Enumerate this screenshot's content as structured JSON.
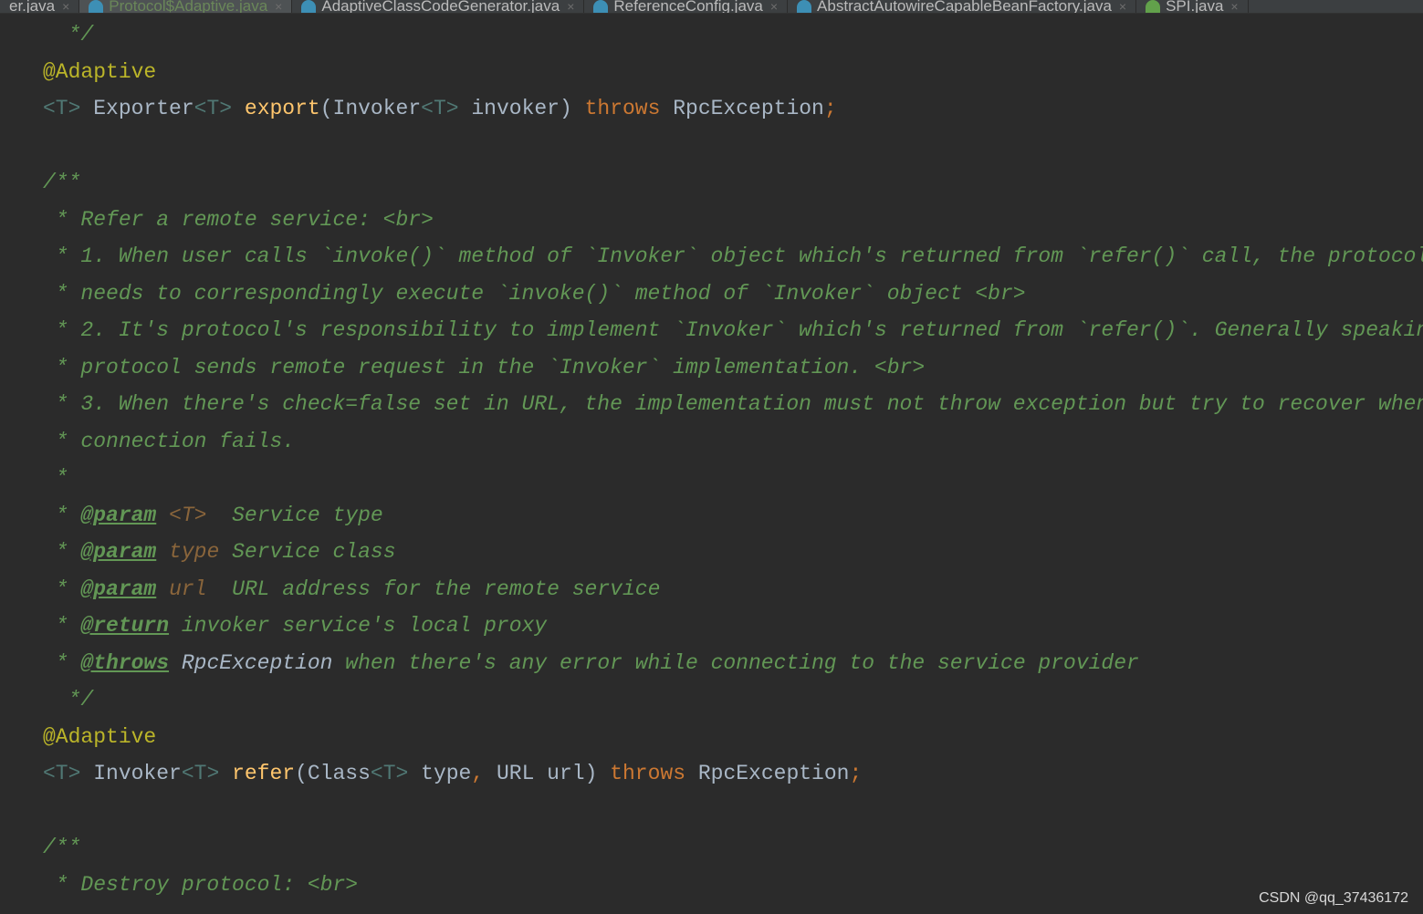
{
  "tabs": [
    {
      "label": "er.java",
      "icon": "java-class-icon",
      "active": false
    },
    {
      "label": "Protocol$Adaptive.java",
      "icon": "java-class-icon",
      "active": true
    },
    {
      "label": "AdaptiveClassCodeGenerator.java",
      "icon": "java-class-locked-icon",
      "active": false
    },
    {
      "label": "ReferenceConfig.java",
      "icon": "java-class-locked-icon",
      "active": false
    },
    {
      "label": "AbstractAutowireCapableBeanFactory.java",
      "icon": "java-class-locked-icon",
      "active": false
    },
    {
      "label": "SPI.java",
      "icon": "java-interface-locked-icon",
      "active": false
    }
  ],
  "close_glyph": "×",
  "code_lines": [
    [
      {
        "t": "  */",
        "c": "c"
      }
    ],
    [
      {
        "t": "@Adaptive",
        "c": "a"
      }
    ],
    [
      {
        "t": "<T>",
        "c": "tp"
      },
      {
        "t": " Exporter"
      },
      {
        "t": "<T>",
        "c": "tp"
      },
      {
        "t": " "
      },
      {
        "t": "export",
        "c": "m"
      },
      {
        "t": "(Invoker"
      },
      {
        "t": "<T>",
        "c": "tp"
      },
      {
        "t": " invoker) "
      },
      {
        "t": "throws",
        "c": "k"
      },
      {
        "t": " RpcException"
      },
      {
        "t": ";",
        "c": "k"
      }
    ],
    [],
    [
      {
        "t": "/**",
        "c": "c"
      }
    ],
    [
      {
        "t": " * Refer a remote service: <br>",
        "c": "c"
      }
    ],
    [
      {
        "t": " * 1. When user calls `invoke()` method of `Invoker` object which's returned from `refer()` call, the protocol",
        "c": "c"
      }
    ],
    [
      {
        "t": " * needs to correspondingly execute `invoke()` method of `Invoker` object <br>",
        "c": "c"
      }
    ],
    [
      {
        "t": " * 2. It's protocol's responsibility to implement `Invoker` which's returned from `refer()`. Generally speaking,",
        "c": "c"
      }
    ],
    [
      {
        "t": " * protocol sends remote request in the `Invoker` implementation. <br>",
        "c": "c"
      }
    ],
    [
      {
        "t": " * 3. When there's check=false set in URL, the implementation must not throw exception but try to recover when",
        "c": "c"
      }
    ],
    [
      {
        "t": " * connection fails.",
        "c": "c"
      }
    ],
    [
      {
        "t": " *",
        "c": "c"
      }
    ],
    [
      {
        "t": " * ",
        "c": "c"
      },
      {
        "t": "@param",
        "c": "tag"
      },
      {
        "t": " "
      },
      {
        "t": "<T>",
        "c": "tpc"
      },
      {
        "t": "  Service type",
        "c": "c"
      }
    ],
    [
      {
        "t": " * ",
        "c": "c"
      },
      {
        "t": "@param",
        "c": "tag"
      },
      {
        "t": " "
      },
      {
        "t": "type",
        "c": "pn"
      },
      {
        "t": " Service class",
        "c": "c"
      }
    ],
    [
      {
        "t": " * ",
        "c": "c"
      },
      {
        "t": "@param",
        "c": "tag"
      },
      {
        "t": " "
      },
      {
        "t": "url",
        "c": "pn"
      },
      {
        "t": "  URL address for the remote service",
        "c": "c"
      }
    ],
    [
      {
        "t": " * ",
        "c": "c"
      },
      {
        "t": "@return",
        "c": "tag"
      },
      {
        "t": " invoker service's local proxy",
        "c": "c"
      }
    ],
    [
      {
        "t": " * ",
        "c": "c"
      },
      {
        "t": "@throws",
        "c": "tag"
      },
      {
        "t": " "
      },
      {
        "t": "RpcException",
        "c": "ref"
      },
      {
        "t": " when there's any error while connecting to the service provider",
        "c": "c"
      }
    ],
    [
      {
        "t": "  */",
        "c": "c"
      }
    ],
    [
      {
        "t": "@Adaptive",
        "c": "a"
      }
    ],
    [
      {
        "t": "<T>",
        "c": "tp"
      },
      {
        "t": " Invoker"
      },
      {
        "t": "<T>",
        "c": "tp"
      },
      {
        "t": " "
      },
      {
        "t": "refer",
        "c": "m"
      },
      {
        "t": "(Class"
      },
      {
        "t": "<T>",
        "c": "tp"
      },
      {
        "t": " type"
      },
      {
        "t": ",",
        "c": "k"
      },
      {
        "t": " URL url) "
      },
      {
        "t": "throws",
        "c": "k"
      },
      {
        "t": " RpcException"
      },
      {
        "t": ";",
        "c": "k"
      }
    ],
    [],
    [
      {
        "t": "/**",
        "c": "c"
      }
    ],
    [
      {
        "t": " * Destroy protocol: <br>",
        "c": "c"
      }
    ]
  ],
  "watermark": "CSDN @qq_37436172",
  "colors": {
    "background": "#2b2b2b",
    "comment": "#629755",
    "keyword": "#cc7832",
    "annotation": "#bbb529",
    "method": "#ffc66d",
    "type_param": "#507874",
    "text": "#a9b7c6"
  }
}
